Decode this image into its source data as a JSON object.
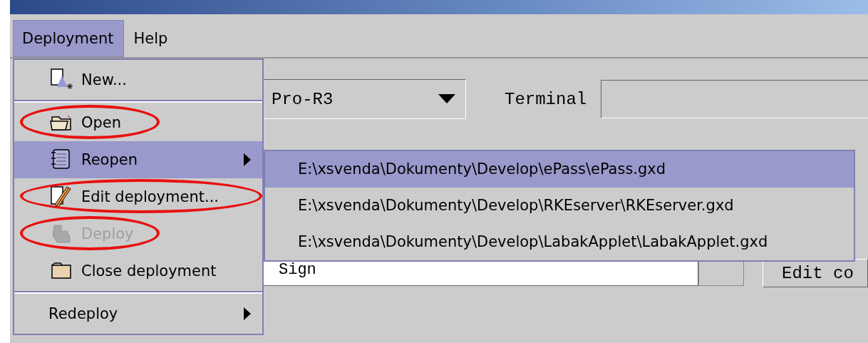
{
  "menubar": [
    {
      "label": "Deployment",
      "selected": true
    },
    {
      "label": "Help",
      "selected": false
    }
  ],
  "form": {
    "combo_value": "Pro-R3",
    "terminal_label": "Terminal",
    "sign_value": "Sign",
    "edit_button": "Edit co"
  },
  "menu": [
    {
      "kind": "new",
      "label": "New...",
      "selected": false,
      "disabled": false,
      "circled": false,
      "has_submenu": false
    },
    {
      "kind": "separator"
    },
    {
      "kind": "open",
      "label": "Open",
      "selected": false,
      "disabled": false,
      "circled": true,
      "has_submenu": false
    },
    {
      "kind": "reopen",
      "label": "Reopen",
      "selected": true,
      "disabled": false,
      "circled": false,
      "has_submenu": true
    },
    {
      "kind": "edit",
      "label": "Edit deployment...",
      "selected": false,
      "disabled": false,
      "circled": true,
      "has_submenu": false
    },
    {
      "kind": "deploy",
      "label": "Deploy",
      "selected": false,
      "disabled": true,
      "circled": true,
      "has_submenu": false
    },
    {
      "kind": "close",
      "label": "Close deployment",
      "selected": false,
      "disabled": false,
      "circled": false,
      "has_submenu": false
    },
    {
      "kind": "separator"
    },
    {
      "kind": "plain",
      "label": "Redeploy",
      "selected": false,
      "disabled": false,
      "circled": false,
      "has_submenu": true
    }
  ],
  "submenu": [
    {
      "label": "E:\\xsvenda\\Dokumenty\\Develop\\ePass\\ePass.gxd",
      "selected": true
    },
    {
      "label": "E:\\xsvenda\\Dokumenty\\Develop\\RKEserver\\RKEserver.gxd",
      "selected": false
    },
    {
      "label": "E:\\xsvenda\\Dokumenty\\Develop\\LabakApplet\\LabakApplet.gxd",
      "selected": false
    }
  ]
}
